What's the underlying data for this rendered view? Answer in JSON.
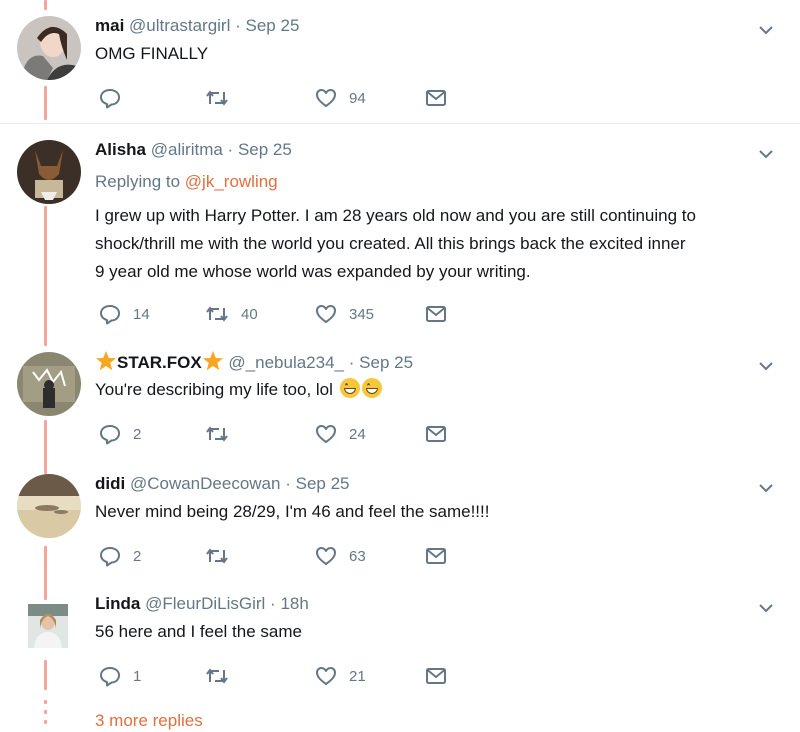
{
  "tweets": [
    {
      "name": "mai",
      "handle": "@ultrastargirl",
      "dot": "·",
      "time": "Sep 25",
      "text_lines": [
        "OMG FINALLY"
      ],
      "reply_count": "",
      "retweet_count": "",
      "like_count": "94"
    },
    {
      "name": "Alisha",
      "handle": "@aliritma",
      "dot": "·",
      "time": "Sep 25",
      "replying_prefix": "Replying to",
      "replying_mention": "@jk_rowling",
      "text_lines": [
        "I grew up with Harry Potter. I am 28 years old now and you are still continuing to",
        "shock/thrill me with the world you created. All this brings back the excited inner",
        "9 year old me whose world was expanded by your writing."
      ],
      "reply_count": "14",
      "retweet_count": "40",
      "like_count": "345"
    },
    {
      "name": "STAR.FOX",
      "handle": "@_nebula234_",
      "dot": "·",
      "time": "Sep 25",
      "text_lines": [
        "You're describing my life too, lol"
      ],
      "reply_count": "2",
      "retweet_count": "",
      "like_count": "24"
    },
    {
      "name": "didi",
      "handle": "@CowanDeecowan",
      "dot": "·",
      "time": "Sep 25",
      "text_lines": [
        "Never mind being 28/29, I'm 46 and feel the same!!!!"
      ],
      "reply_count": "2",
      "retweet_count": "",
      "like_count": "63"
    },
    {
      "name": "Linda",
      "handle": "@FleurDiLisGirl",
      "dot": "·",
      "time": "18h",
      "text_lines": [
        "56 here and I feel the same"
      ],
      "reply_count": "1",
      "retweet_count": "",
      "like_count": "21"
    }
  ],
  "more_replies": "3 more replies",
  "colors": {
    "accent": "#e0703e",
    "thread_line": "#f5a59b",
    "muted": "#657786",
    "text": "#14171a",
    "divider": "#e6ecf0"
  },
  "icons": [
    "reply-icon",
    "retweet-icon",
    "heart-icon",
    "dm-icon",
    "chevron-down-icon",
    "star-icon",
    "grinning-emoji-icon"
  ]
}
